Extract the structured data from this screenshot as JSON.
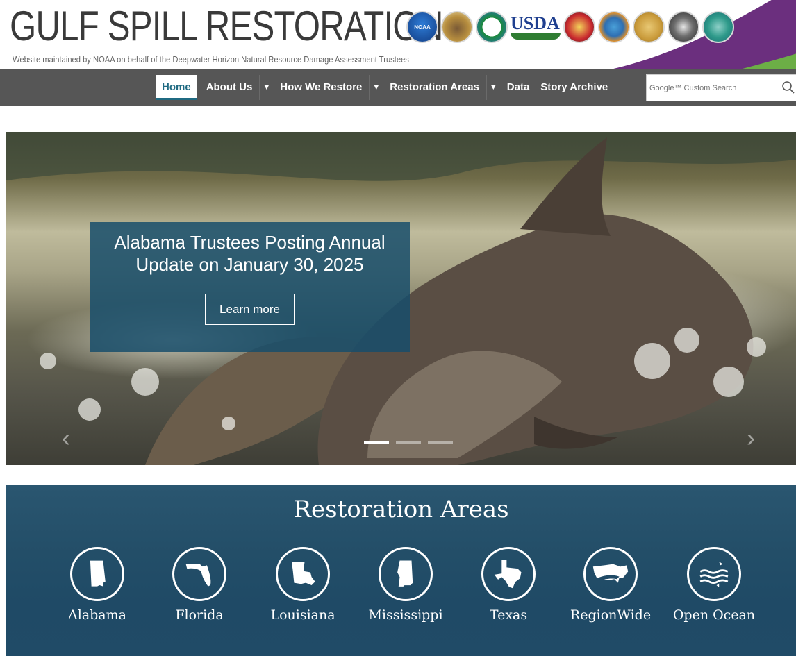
{
  "header": {
    "title": "GULF SPILL RESTORATION",
    "subtitle": "Website maintained by NOAA on behalf of the Deepwater Horizon Natural Resource Damage Assessment Trustees",
    "usda_text": "USDA",
    "seal_noaa_text": "NOAA",
    "colors": {
      "swoosh_purple": "#6b2f7e",
      "swoosh_green": "#6cae46",
      "nav_bg": "#565656",
      "accent": "#1f6a82"
    }
  },
  "nav": {
    "items": [
      {
        "label": "Home",
        "active": true
      },
      {
        "label": "About Us",
        "dropdown": true
      },
      {
        "label": "How We Restore",
        "dropdown": true
      },
      {
        "label": "Restoration Areas",
        "dropdown": true
      },
      {
        "label": "Data"
      },
      {
        "label": "Story Archive"
      }
    ],
    "search_placeholder": "Google™ Custom Search"
  },
  "hero": {
    "slide_title": "Alabama Trustees Posting Annual Update on January 30, 2025",
    "button_label": "Learn more",
    "slide_count": 3,
    "active_slide": 1
  },
  "areas": {
    "title": "Restoration Areas",
    "items": [
      {
        "label": "Alabama",
        "icon": "alabama-state-icon"
      },
      {
        "label": "Florida",
        "icon": "florida-state-icon"
      },
      {
        "label": "Louisiana",
        "icon": "louisiana-state-icon"
      },
      {
        "label": "Mississippi",
        "icon": "mississippi-state-icon"
      },
      {
        "label": "Texas",
        "icon": "texas-state-icon"
      },
      {
        "label": "RegionWide",
        "icon": "us-map-icon"
      },
      {
        "label": "Open Ocean",
        "icon": "ocean-waves-icon"
      }
    ]
  }
}
